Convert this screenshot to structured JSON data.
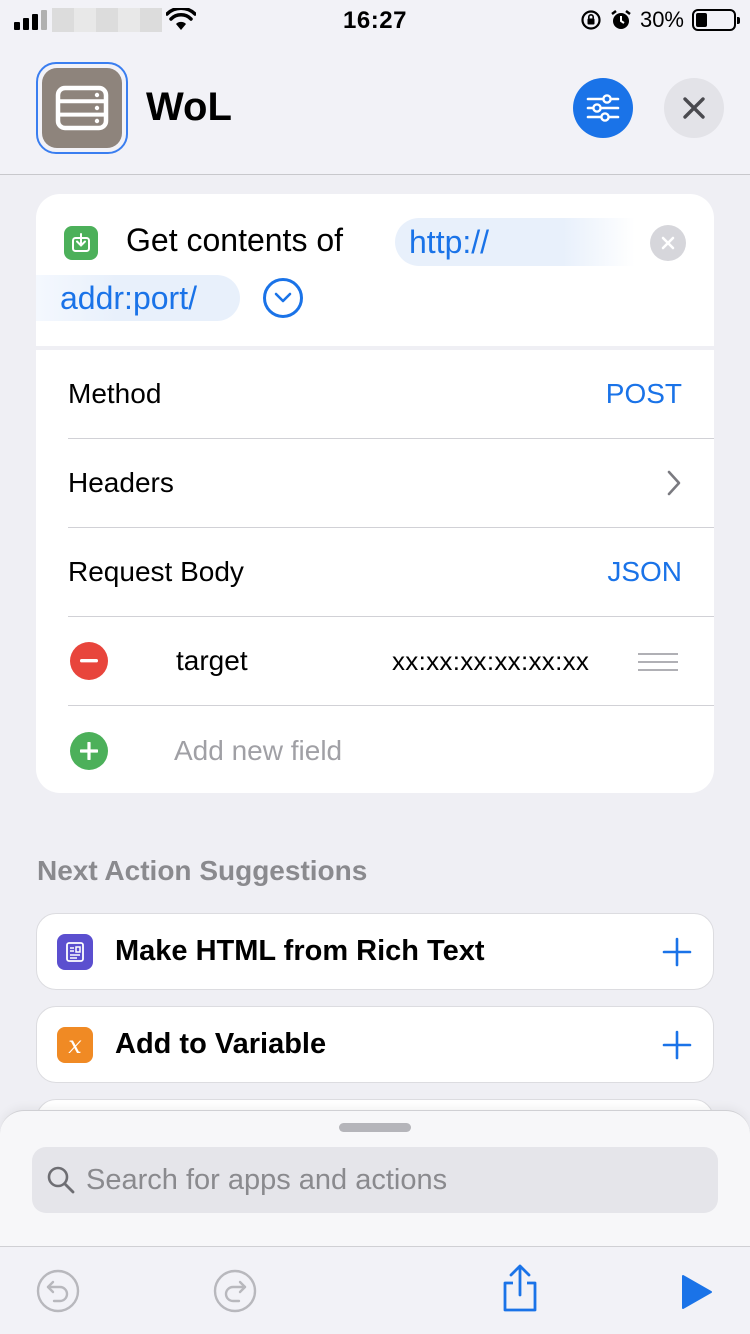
{
  "status_bar": {
    "time": "16:27",
    "battery_percent": "30%",
    "battery_level": 0.3
  },
  "header": {
    "title": "WoL"
  },
  "action": {
    "prefix": "Get contents of",
    "url_part1": "http://",
    "url_part2": "addr:port/",
    "rows": {
      "method_label": "Method",
      "method_value": "POST",
      "headers_label": "Headers",
      "body_label": "Request Body",
      "body_value": "JSON"
    },
    "field": {
      "key": "target",
      "value": "xx:xx:xx:xx:xx:xx"
    },
    "add_field_label": "Add new field"
  },
  "suggestions": {
    "title": "Next Action Suggestions",
    "items": [
      {
        "label": "Make HTML from Rich Text",
        "icon": "rich-text-icon",
        "color": "#5b4fcf"
      },
      {
        "label": "Add to Variable",
        "icon": "variable-icon",
        "color": "#f08a24"
      }
    ]
  },
  "search": {
    "placeholder": "Search for apps and actions"
  },
  "colors": {
    "accent": "#1a73e8",
    "remove": "#e8453c",
    "add": "#4cb05a"
  }
}
